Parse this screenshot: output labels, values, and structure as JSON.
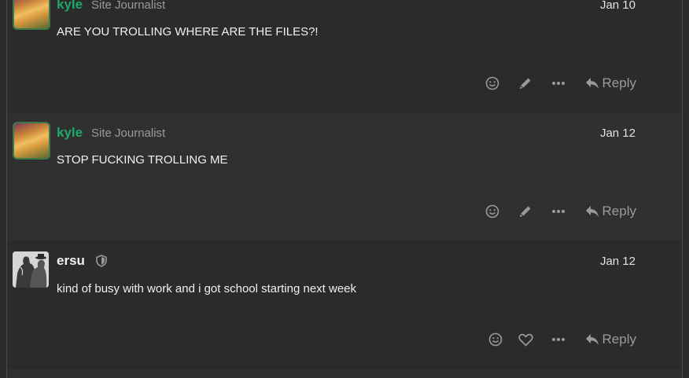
{
  "posts": [
    {
      "username": "kyle",
      "user_title": "Site Journalist",
      "date": "Jan 10",
      "body": "ARE YOU TROLLING WHERE ARE THE FILES?!",
      "reply_label": "Reply"
    },
    {
      "username": "kyle",
      "user_title": "Site Journalist",
      "date": "Jan 12",
      "body": "STOP FUCKING TROLLING ME",
      "reply_label": "Reply"
    },
    {
      "username": "ersu",
      "date": "Jan 12",
      "body": "kind of busy with work and i got school starting next week",
      "reply_label": "Reply"
    }
  ],
  "colors": {
    "username_staff": "#1ea86a",
    "background": "#2b2b2b",
    "highlight_background": "#303030"
  }
}
